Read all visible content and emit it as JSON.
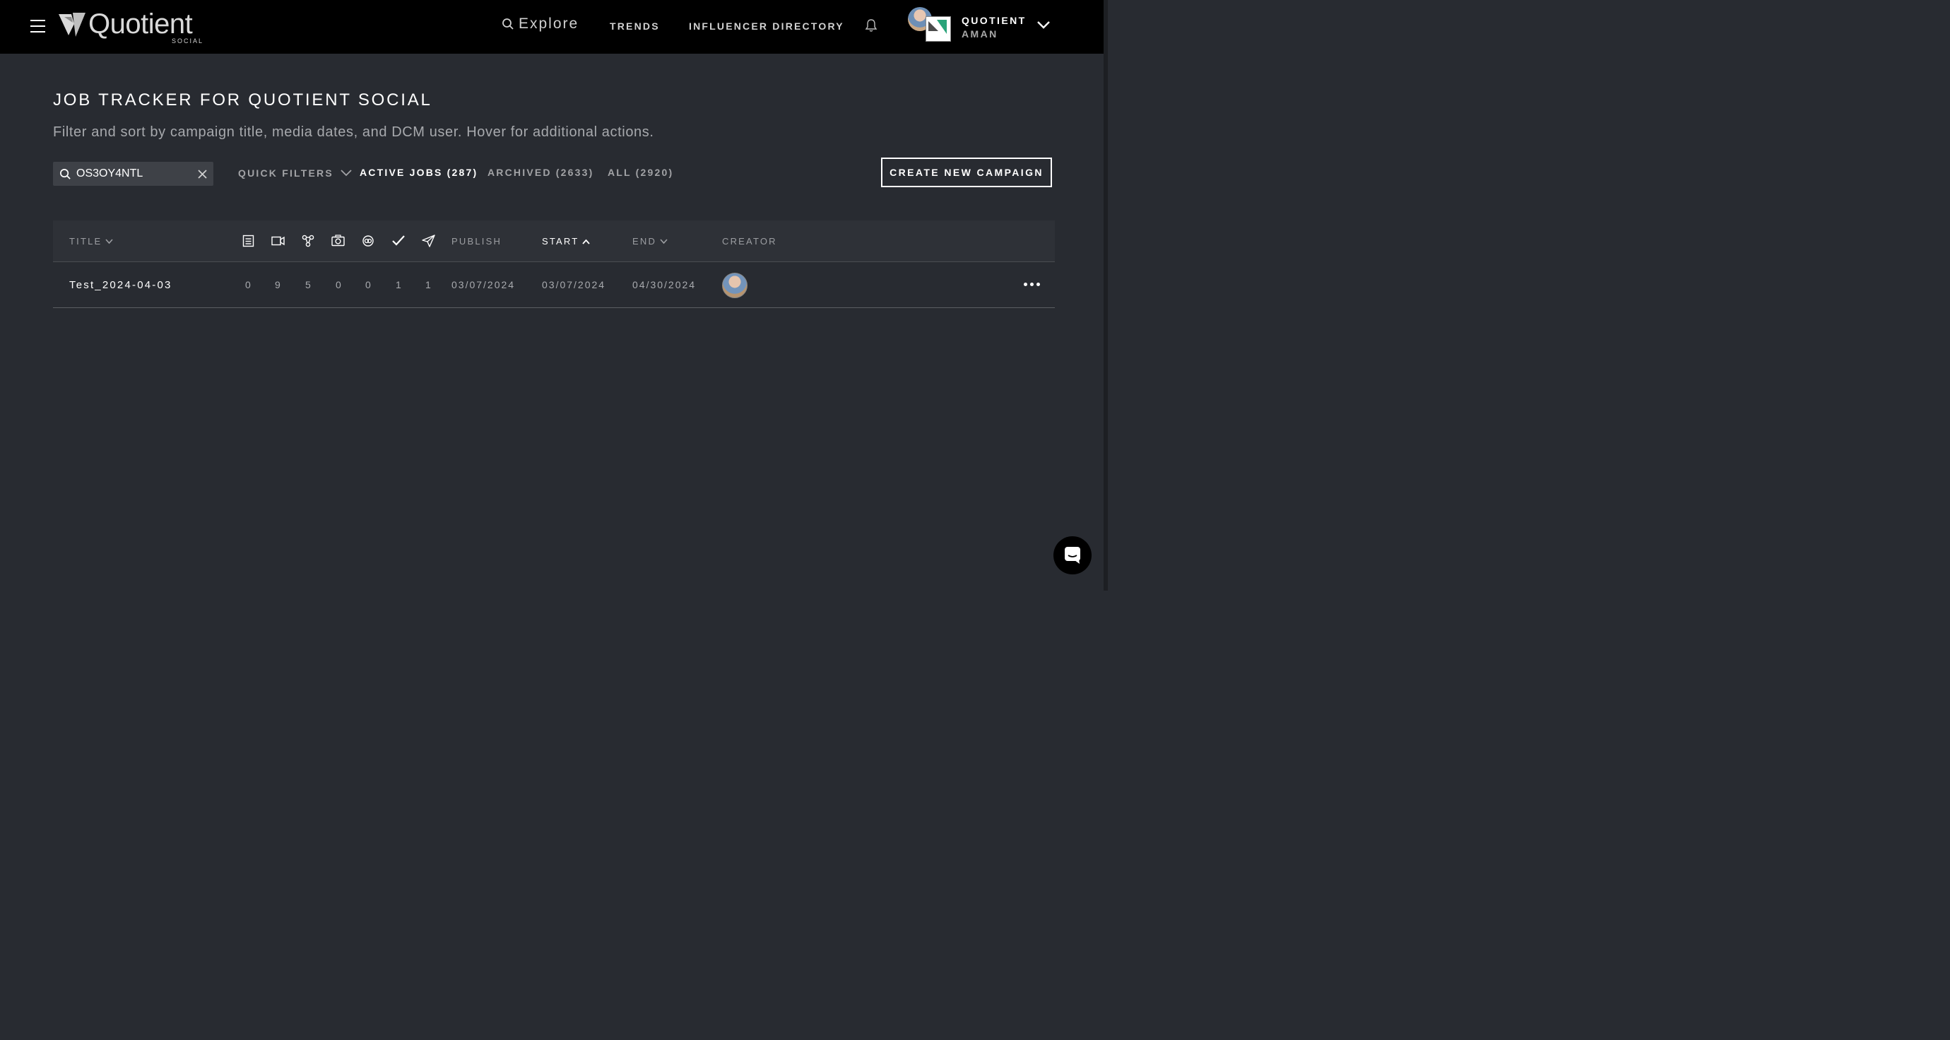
{
  "nav": {
    "logo_text": "Quotient",
    "logo_sub": "SOCIAL",
    "explore": "Explore",
    "trends": "TRENDS",
    "influencer_directory": "INFLUENCER DIRECTORY",
    "account_name": "QUOTIENT",
    "account_user": "AMAN"
  },
  "page": {
    "title": "JOB TRACKER FOR QUOTIENT SOCIAL",
    "subtitle": "Filter and sort by campaign title, media dates, and DCM user. Hover for additional actions."
  },
  "search": {
    "value": "OS3OY4NTL"
  },
  "filters": {
    "quick_filters": "QUICK FILTERS",
    "active": "ACTIVE JOBS (287)",
    "archived": "ARCHIVED (2633)",
    "all": "ALL (2920)"
  },
  "create_button": "CREATE NEW CAMPAIGN",
  "table": {
    "headers": {
      "title": "TITLE",
      "publish": "PUBLISH",
      "start": "START",
      "end": "END",
      "creator": "CREATOR"
    },
    "icon_columns": [
      "article-icon",
      "video-icon",
      "share-network-icon",
      "camera-icon",
      "link-icon",
      "check-icon",
      "send-icon"
    ],
    "rows": [
      {
        "title": "Test_2024-04-03",
        "counts": [
          "0",
          "9",
          "5",
          "0",
          "0",
          "1",
          "1"
        ],
        "publish": "03/07/2024",
        "start": "03/07/2024",
        "end": "04/30/2024"
      }
    ]
  }
}
